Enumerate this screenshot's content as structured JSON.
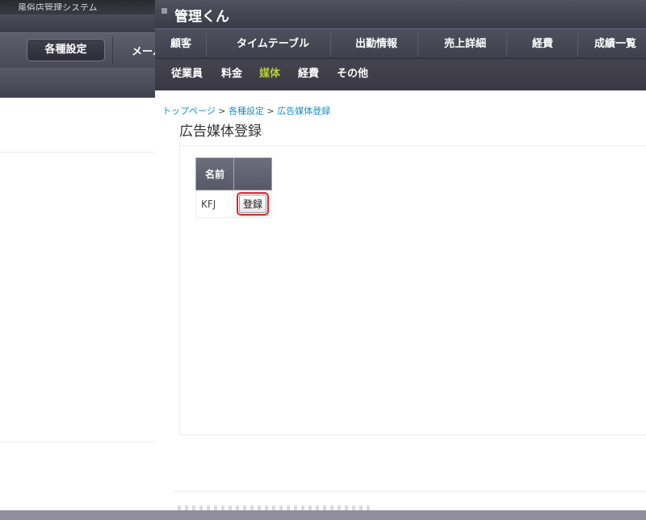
{
  "background_window": {
    "title": "風俗店管理システム",
    "active_nav": "各種設定",
    "next_nav": "メール"
  },
  "app": {
    "title": "管理くん"
  },
  "nav": {
    "items": [
      {
        "label": "顧客"
      },
      {
        "label": "タイムテーブル"
      },
      {
        "label": "出勤情報"
      },
      {
        "label": "売上詳細"
      },
      {
        "label": "経費"
      },
      {
        "label": "成績一覧"
      }
    ]
  },
  "subnav": {
    "items": [
      {
        "label": "従業員",
        "active": false
      },
      {
        "label": "料金",
        "active": false
      },
      {
        "label": "媒体",
        "active": true
      },
      {
        "label": "経費",
        "active": false
      },
      {
        "label": "その他",
        "active": false
      }
    ]
  },
  "breadcrumb": {
    "home": "トップページ",
    "settings": "各種設定",
    "current": "広告媒体登録",
    "separator": ">"
  },
  "page": {
    "title": "広告媒体登録"
  },
  "table": {
    "headers": [
      "名前",
      ""
    ],
    "rows": [
      {
        "name": "KFJ",
        "action_label": "登録"
      }
    ]
  },
  "colors": {
    "active_subnav": "#b5cc3c",
    "link": "#1a8fc0",
    "highlight": "#d9262c"
  }
}
